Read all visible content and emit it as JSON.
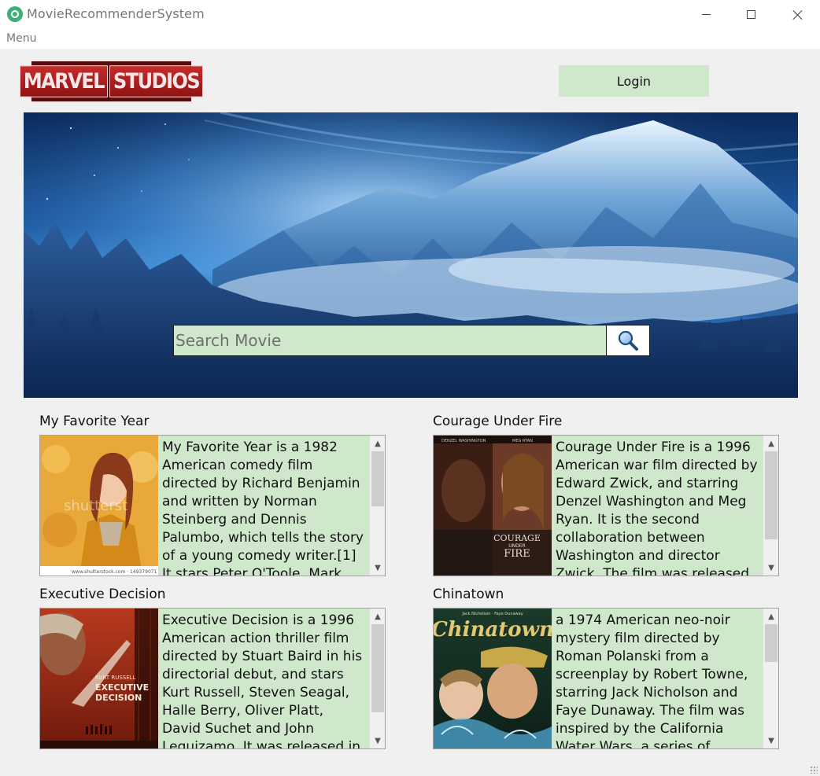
{
  "window": {
    "title": "MovieRecommenderSystem"
  },
  "menu": {
    "label": "Menu"
  },
  "header": {
    "logo_text_left": "MARVEL",
    "logo_text_right": "STUDIOS",
    "login_label": "Login"
  },
  "search": {
    "placeholder": "Search Movie",
    "value": ""
  },
  "movies": [
    {
      "title": "My Favorite Year",
      "description": "My Favorite Year is a 1982 American comedy film directed by Richard Benjamin and written by Norman Steinberg and Dennis Palumbo, which tells the story of a young comedy writer.[1] It stars Peter O'Toole, Mark Linn-Baker",
      "watermark": "shutterst",
      "caption": "www.shutterstock.com · 149379071",
      "scroll_position": 0.0,
      "scroll_visible_fraction": 0.4
    },
    {
      "title": "Courage Under Fire",
      "description": "Courage Under Fire is a 1996 American war film directed by Edward Zwick, and starring Denzel Washington and Meg Ryan. It is the second collaboration between Washington and director Zwick. The film was released in the",
      "poster_credits": [
        "DENZEL WASHINGTON",
        "MEG RYAN"
      ],
      "poster_title_line1": "COURAGE",
      "poster_title_line2": "UNDER",
      "poster_title_line3": "FIRE",
      "scroll_position": 0.0,
      "scroll_visible_fraction": 0.8
    },
    {
      "title": "Executive Decision",
      "description": "Executive Decision is a 1996 American action thriller film directed by Stuart Baird in his directorial debut, and stars Kurt Russell, Steven Seagal, Halle Berry, Oliver Platt, David Suchet and John Leguizamo. It was released in the United States",
      "poster_actor": "KURT RUSSELL",
      "poster_title_line1": "EXECUTIVE",
      "poster_title_line2": "DECISION",
      "scroll_position": 0.0,
      "scroll_visible_fraction": 0.8
    },
    {
      "title": "Chinatown",
      "description": "a 1974 American neo-noir mystery film directed by Roman Polanski from a screenplay by Robert Towne, starring Jack Nicholson and Faye Dunaway. The film was inspired by the California Water Wars, a series of disputes over",
      "poster_credits": "Jack Nicholson · Faye Dunaway",
      "poster_title": "Chinatown",
      "scroll_position": 0.0,
      "scroll_visible_fraction": 0.36
    }
  ],
  "colors": {
    "accent_green": "#cfe8cc",
    "window_bg": "#f0f0f0",
    "logo_red": "#c72b2b"
  },
  "icons": {
    "app": "film-reel-icon",
    "search": "magnifier-icon",
    "scroll_up": "chevron-up-icon",
    "scroll_down": "chevron-down-icon"
  }
}
